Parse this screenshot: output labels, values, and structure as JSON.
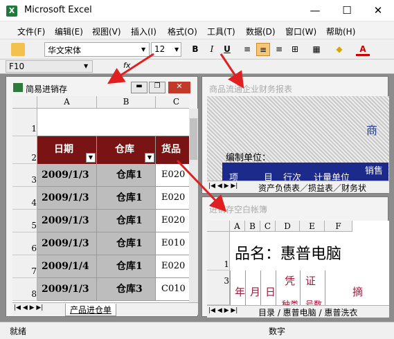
{
  "app": {
    "title": "Microsoft Excel",
    "icon": "excel-icon",
    "icon_glyph": "X"
  },
  "window_controls": {
    "minimize": "—",
    "maximize": "☐",
    "close": "✕"
  },
  "menu": [
    "文件(F)",
    "编辑(E)",
    "视图(V)",
    "插入(I)",
    "格式(O)",
    "工具(T)",
    "数据(D)",
    "窗口(W)",
    "帮助(H)"
  ],
  "toolbar": {
    "font_name": "华文宋体",
    "font_size": "12",
    "bold": "B",
    "italic": "I",
    "underline": "U",
    "font_color_label": "A"
  },
  "formula": {
    "name_box": "F10",
    "fx": "fx",
    "value": ""
  },
  "windows": {
    "inventory": {
      "title": "简易进销存",
      "columns": [
        "A",
        "B",
        "C"
      ],
      "rows": [
        "1",
        "2",
        "3",
        "4",
        "5",
        "6",
        "7",
        "8"
      ],
      "header": [
        "日期",
        "仓库",
        "货品"
      ],
      "data": [
        [
          "2009/1/3",
          "仓库1",
          "E020"
        ],
        [
          "2009/1/3",
          "仓库1",
          "E020"
        ],
        [
          "2009/1/3",
          "仓库1",
          "E020"
        ],
        [
          "2009/1/3",
          "仓库1",
          "E010"
        ],
        [
          "2009/1/4",
          "仓库1",
          "E020"
        ],
        [
          "2009/1/3",
          "仓库3",
          "C010"
        ]
      ],
      "sheet_tab": "产品进仓单"
    },
    "finance": {
      "title": "商品流通企业财务报表",
      "banner_char": "商",
      "label": "编制单位：",
      "header": [
        "项",
        "目",
        "行次",
        "计量单位",
        "销售"
      ],
      "sheet_tabs": "资产负债表／损益表／财务状"
    },
    "ledger": {
      "title": "进销存空白帐簿",
      "columns": [
        "A",
        "B",
        "C",
        "D",
        "E",
        "F"
      ],
      "rows": [
        "1",
        "3"
      ],
      "product_label": "品名：",
      "product_name": "惠普电脑",
      "row3": [
        "年",
        "月",
        "日",
        "凭",
        "证",
        "摘"
      ],
      "row3b": [
        "种类",
        "号数"
      ],
      "sheet_tabs": "目录 / 惠普电脑 / 惠普洗衣"
    }
  },
  "status": {
    "left": "就绪",
    "num": "数字"
  },
  "colors": {
    "header_bg": "#7a1414",
    "selected_cell": "#bdbdbd",
    "mdi_bg": "#8c8c8c",
    "arrow": "#e02020"
  }
}
